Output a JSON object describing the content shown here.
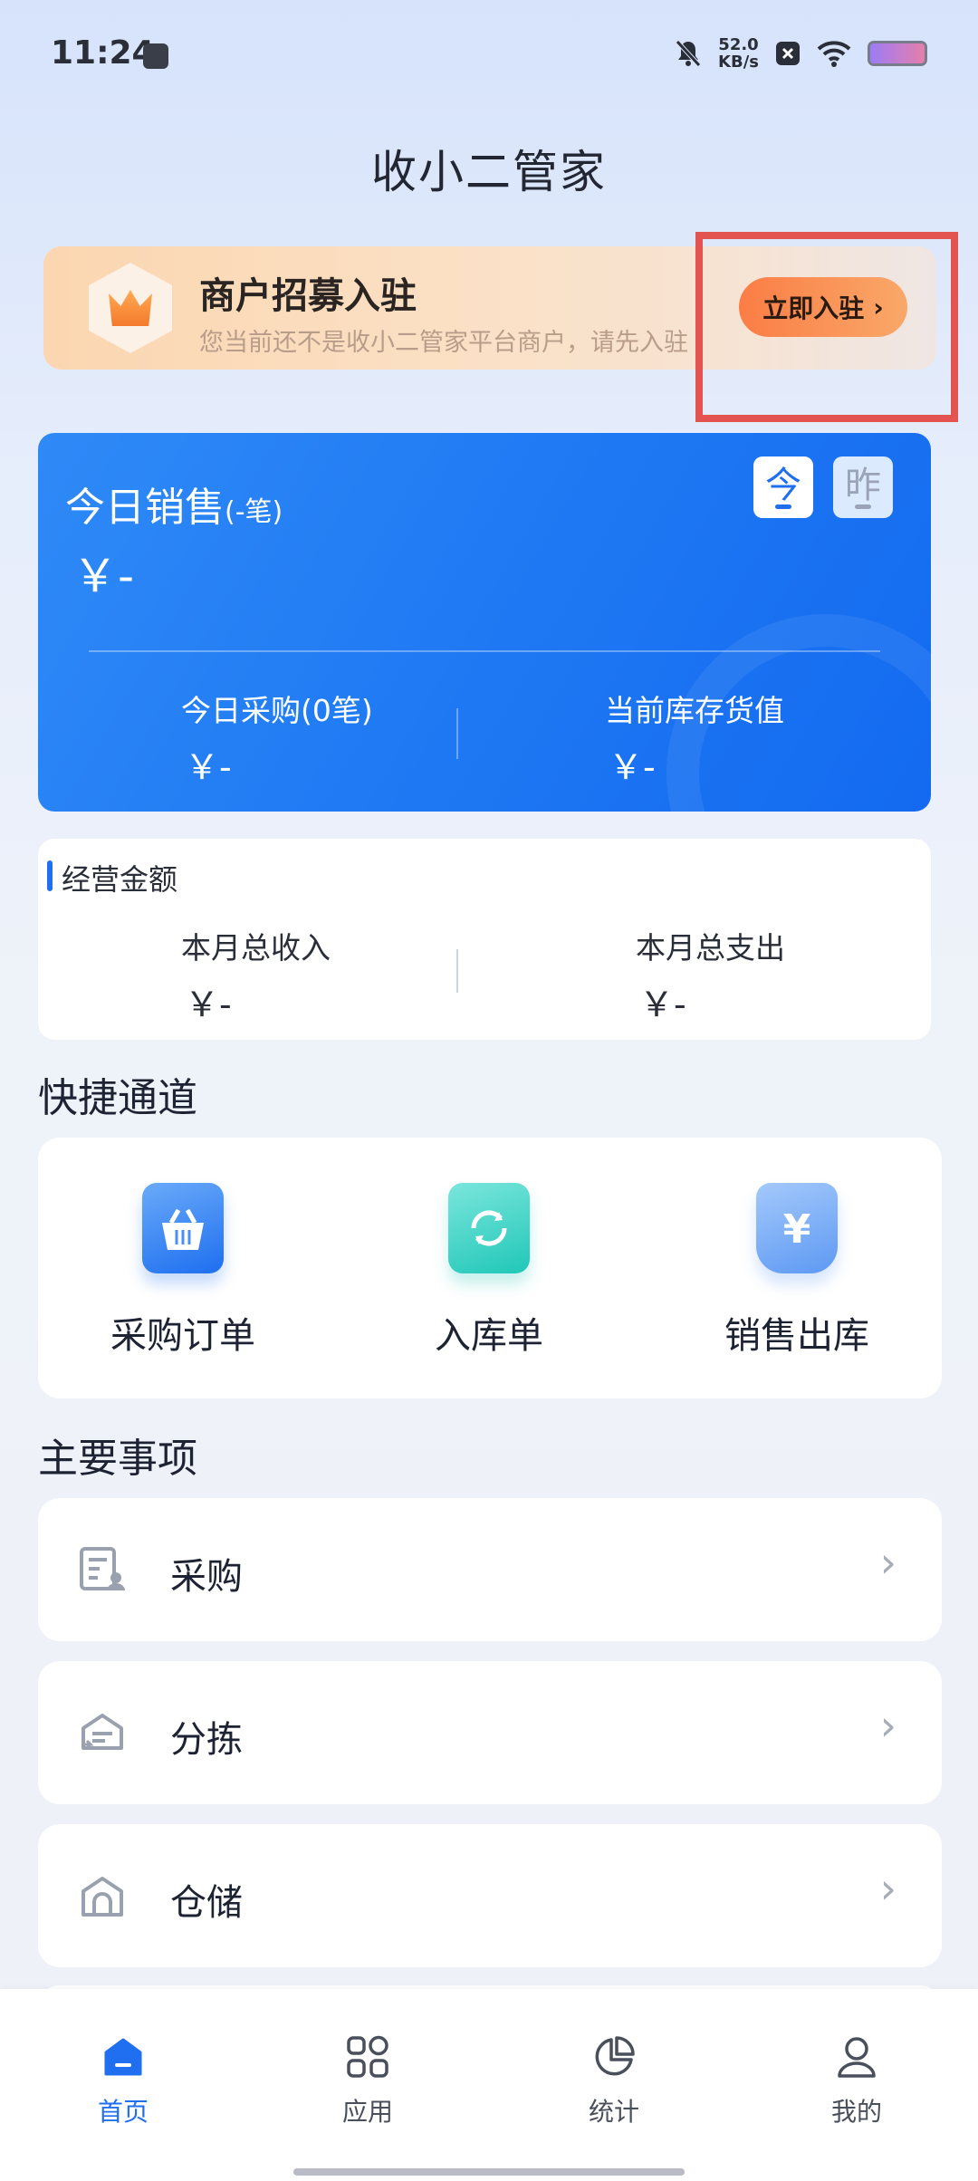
{
  "status_bar": {
    "time": "11:24",
    "net_speed_value": "52.0",
    "net_speed_unit": "KB/s"
  },
  "header": {
    "title": "收小二管家"
  },
  "banner": {
    "title": "商户招募入驻",
    "subtitle": "您当前还不是收小二管家平台商户，请先入驻",
    "join_button": "立即入驻",
    "join_chevron": "›"
  },
  "sales": {
    "title": "今日销售",
    "count": "(-笔)",
    "amount": "￥-",
    "today_btn": "今",
    "yesterday_btn": "昨",
    "purchase_label": "今日采购(0笔)",
    "purchase_value": "￥-",
    "inventory_label": "当前库存货值",
    "inventory_value": "￥-"
  },
  "business": {
    "title": "经营金额",
    "income_label": "本月总收入",
    "income_value": "￥-",
    "expense_label": "本月总支出",
    "expense_value": "￥-"
  },
  "quick": {
    "title": "快捷通道",
    "items": [
      {
        "label": "采购订单",
        "icon": "basket-icon"
      },
      {
        "label": "入库单",
        "icon": "refresh-icon"
      },
      {
        "label": "销售出库",
        "icon": "yuan-icon",
        "glyph": "¥"
      }
    ]
  },
  "main": {
    "title": "主要事项",
    "items": [
      {
        "label": "采购",
        "icon": "purchase-list-icon"
      },
      {
        "label": "分拣",
        "icon": "sorting-icon"
      },
      {
        "label": "仓储",
        "icon": "warehouse-icon"
      }
    ],
    "chevron": "›"
  },
  "tabbar": {
    "items": [
      {
        "label": "首页",
        "icon": "home-icon",
        "active": true
      },
      {
        "label": "应用",
        "icon": "apps-grid-icon",
        "active": false
      },
      {
        "label": "统计",
        "icon": "pie-chart-icon",
        "active": false
      },
      {
        "label": "我的",
        "icon": "user-icon",
        "active": false
      }
    ]
  },
  "colors": {
    "primary": "#1f6ff0",
    "join_button": "#fb7d45",
    "highlight": "#e35451"
  }
}
